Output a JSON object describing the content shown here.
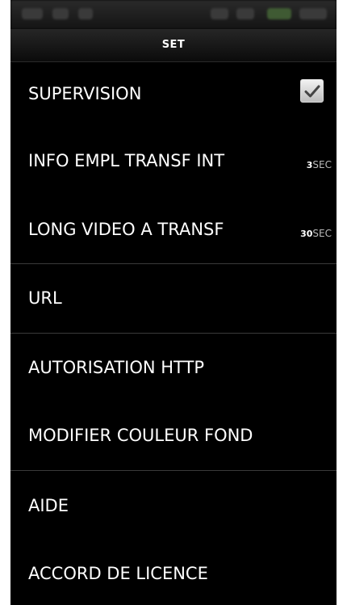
{
  "header": {
    "title": "SET"
  },
  "settings": {
    "supervision": {
      "label": "SUPERVISION",
      "checked": true,
      "icon": "checkmark-icon"
    },
    "info_interval": {
      "label": "INFO EMPL TRANSF INT",
      "value": "3",
      "unit": "SEC"
    },
    "video_length": {
      "label": "LONG VIDEO A TRANSF",
      "value": "30",
      "unit": "SEC"
    },
    "url": {
      "label": "URL"
    },
    "http_auth": {
      "label": "AUTORISATION HTTP"
    },
    "background_color": {
      "label": "MODIFIER COULEUR FOND"
    },
    "help": {
      "label": "AIDE"
    },
    "license": {
      "label": "ACCORD DE LICENCE"
    }
  },
  "colors": {
    "background": "#000000",
    "text": "#ffffff",
    "divider": "#3a3a3a"
  }
}
